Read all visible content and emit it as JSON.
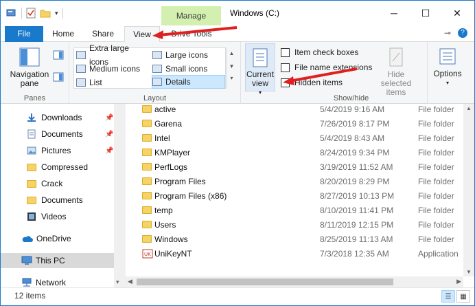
{
  "window": {
    "title": "Windows (C:)",
    "manage_tab": "Manage",
    "minimize": "─",
    "maximize": "☐",
    "close": "✕"
  },
  "ribbon_tabs": {
    "file": "File",
    "home": "Home",
    "share": "Share",
    "view": "View",
    "drive_tools": "Drive Tools"
  },
  "panes": {
    "navigation_pane": "Navigation pane",
    "group_label": "Panes"
  },
  "layout": {
    "items": [
      "Extra large icons",
      "Large icons",
      "Medium icons",
      "Small icons",
      "List",
      "Details"
    ],
    "selected": "Details",
    "group_label": "Layout"
  },
  "current_view": {
    "label": "Current view"
  },
  "show_hide": {
    "item_check_boxes": "Item check boxes",
    "file_name_extensions": "File name extensions",
    "hidden_items": "Hidden items",
    "hide_selected_items": "Hide selected items",
    "group_label": "Show/hide"
  },
  "options": {
    "label": "Options"
  },
  "nav": {
    "items": [
      {
        "label": "Downloads",
        "icon": "download-icon",
        "pinned": true
      },
      {
        "label": "Documents",
        "icon": "documents-icon",
        "pinned": true
      },
      {
        "label": "Pictures",
        "icon": "pictures-icon",
        "pinned": true
      },
      {
        "label": "Compressed",
        "icon": "folder-icon",
        "pinned": false
      },
      {
        "label": "Crack",
        "icon": "folder-icon",
        "pinned": false
      },
      {
        "label": "Documents",
        "icon": "folder-icon",
        "pinned": false
      },
      {
        "label": "Videos",
        "icon": "videos-icon",
        "pinned": false
      },
      {
        "label": "OneDrive",
        "icon": "cloud-icon",
        "pinned": false
      },
      {
        "label": "This PC",
        "icon": "computer-icon",
        "pinned": false
      },
      {
        "label": "Network",
        "icon": "network-icon",
        "pinned": false
      }
    ]
  },
  "files": [
    {
      "name": "active",
      "date": "5/4/2019 9:16 AM",
      "type": "File folder"
    },
    {
      "name": "Garena",
      "date": "7/26/2019 8:17 PM",
      "type": "File folder"
    },
    {
      "name": "Intel",
      "date": "5/4/2019 8:43 AM",
      "type": "File folder"
    },
    {
      "name": "KMPlayer",
      "date": "8/24/2019 9:34 PM",
      "type": "File folder"
    },
    {
      "name": "PerfLogs",
      "date": "3/19/2019 11:52 AM",
      "type": "File folder"
    },
    {
      "name": "Program Files",
      "date": "8/20/2019 8:29 PM",
      "type": "File folder"
    },
    {
      "name": "Program Files (x86)",
      "date": "8/27/2019 10:13 PM",
      "type": "File folder"
    },
    {
      "name": "temp",
      "date": "8/10/2019 11:41 PM",
      "type": "File folder"
    },
    {
      "name": "Users",
      "date": "8/11/2019 12:15 PM",
      "type": "File folder"
    },
    {
      "name": "Windows",
      "date": "8/25/2019 11:13 AM",
      "type": "File folder"
    },
    {
      "name": "UniKeyNT",
      "date": "7/3/2018 12:35 AM",
      "type": "Application"
    }
  ],
  "status": {
    "item_count": "12 items"
  },
  "colors": {
    "accent": "#1979ca",
    "manage_tab": "#d4f0b0",
    "annotation_arrow": "#e02020"
  }
}
